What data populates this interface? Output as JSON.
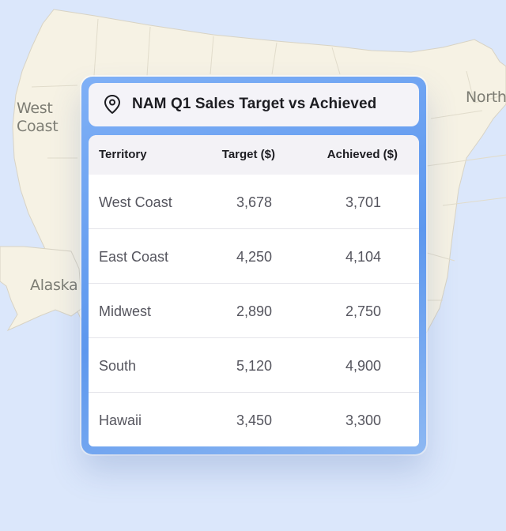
{
  "map": {
    "labels": {
      "west_coast_line1": "West",
      "west_coast_line2": "Coast",
      "alaska": "Alaska",
      "northeast": "Northe"
    }
  },
  "card": {
    "title": "NAM Q1 Sales Target vs Achieved",
    "icon": "location-pin-icon",
    "columns": [
      "Territory",
      "Target ($)",
      "Achieved ($)"
    ],
    "rows": [
      {
        "territory": "West Coast",
        "target": "3,678",
        "achieved": "3,701"
      },
      {
        "territory": "East Coast",
        "target": "4,250",
        "achieved": "4,104"
      },
      {
        "territory": "Midwest",
        "target": "2,890",
        "achieved": "2,750"
      },
      {
        "territory": "South",
        "target": "5,120",
        "achieved": "4,900"
      },
      {
        "territory": "Hawaii",
        "target": "3,450",
        "achieved": "3,300"
      }
    ]
  },
  "colors": {
    "background": "#dbe7fb",
    "land": "#f6f2e4",
    "border": "#5d97ee"
  }
}
